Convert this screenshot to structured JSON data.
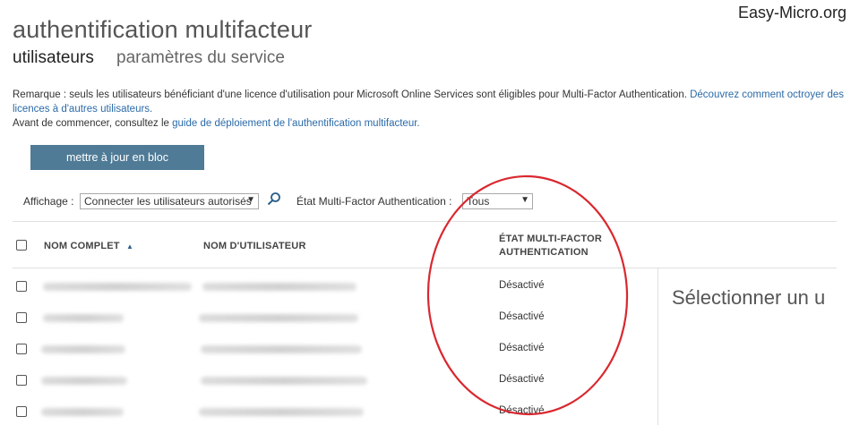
{
  "header": {
    "title": "authentification multifacteur",
    "watermark": "Easy-Micro.org"
  },
  "tabs": [
    {
      "label": "utilisateurs",
      "active": true
    },
    {
      "label": "paramètres du service",
      "active": false
    }
  ],
  "notice": {
    "line1_text": "Remarque : seuls les utilisateurs bénéficiant d'une licence d'utilisation pour Microsoft Online Services sont éligibles pour Multi-Factor Authentication. ",
    "line1_link": "Découvrez comment octroyer des licences à d'autres utilisateurs.",
    "line2_text": "Avant de commencer, consultez le ",
    "line2_link": "guide de déploiement de l'authentification multifacteur."
  },
  "toolbar": {
    "bulk_update_label": "mettre à jour en bloc"
  },
  "filters": {
    "view_label": "Affichage :",
    "view_value": "Connecter les utilisateurs autorisés",
    "mfa_state_label": "État Multi-Factor Authentication :",
    "mfa_state_value": "Tous"
  },
  "table": {
    "columns": {
      "full_name": "NOM COMPLET",
      "username": "NOM D'UTILISATEUR",
      "mfa_state_line1": "ÉTAT MULTI-FACTOR",
      "mfa_state_line2": "AUTHENTICATION"
    },
    "sort_indicator": "▲",
    "rows": [
      {
        "mfa_state": "Désactivé"
      },
      {
        "mfa_state": "Désactivé"
      },
      {
        "mfa_state": "Désactivé"
      },
      {
        "mfa_state": "Désactivé"
      },
      {
        "mfa_state": "Désactivé"
      }
    ]
  },
  "detail_pane": {
    "placeholder": "Sélectionner un u"
  },
  "annotation": {
    "color": "#d9282f"
  },
  "colors": {
    "button_bg": "#4f7b96",
    "link": "#2a6aa8"
  }
}
